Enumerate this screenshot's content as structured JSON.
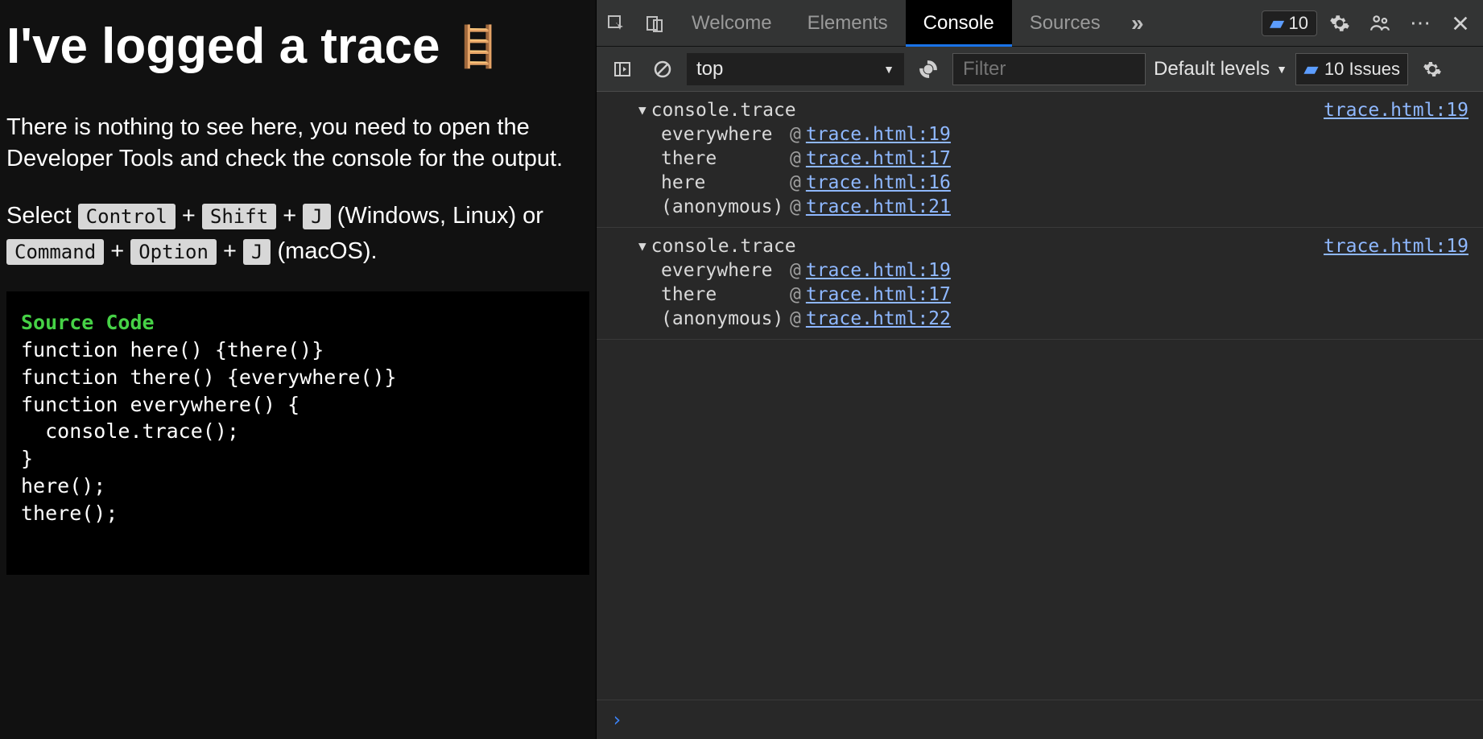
{
  "page": {
    "title": "I've logged a trace",
    "ladder_emoji": "🪜",
    "intro": "There is nothing to see here, you need to open the Developer Tools and check the console for the output.",
    "keys_prefix": "Select ",
    "k_control": "Control",
    "k_shift": "Shift",
    "k_j": "J",
    "keys_mid1": " (Windows, Linux) or ",
    "k_command": "Command",
    "k_option": "Option",
    "k_j2": "J",
    "keys_end": " (macOS).",
    "plus": " + ",
    "code_title": "Source Code",
    "code_body": "function here() {there()}\nfunction there() {everywhere()}\nfunction everywhere() {\n  console.trace();\n}\nhere();\nthere();"
  },
  "devtools": {
    "tabs": {
      "welcome": "Welcome",
      "elements": "Elements",
      "console": "Console",
      "sources": "Sources"
    },
    "msg_count": "10",
    "toolbar": {
      "context": "top",
      "filter_placeholder": "Filter",
      "levels": "Default levels",
      "issues_label": "10 Issues"
    },
    "traces": [
      {
        "header": "console.trace",
        "header_loc": "trace.html:19",
        "frames": [
          {
            "fn": "everywhere",
            "loc": "trace.html:19"
          },
          {
            "fn": "there",
            "loc": "trace.html:17"
          },
          {
            "fn": "here",
            "loc": "trace.html:16"
          },
          {
            "fn": "(anonymous)",
            "loc": "trace.html:21"
          }
        ]
      },
      {
        "header": "console.trace",
        "header_loc": "trace.html:19",
        "frames": [
          {
            "fn": "everywhere",
            "loc": "trace.html:19"
          },
          {
            "fn": "there",
            "loc": "trace.html:17"
          },
          {
            "fn": "(anonymous)",
            "loc": "trace.html:22"
          }
        ]
      }
    ],
    "prompt_glyph": "›"
  }
}
